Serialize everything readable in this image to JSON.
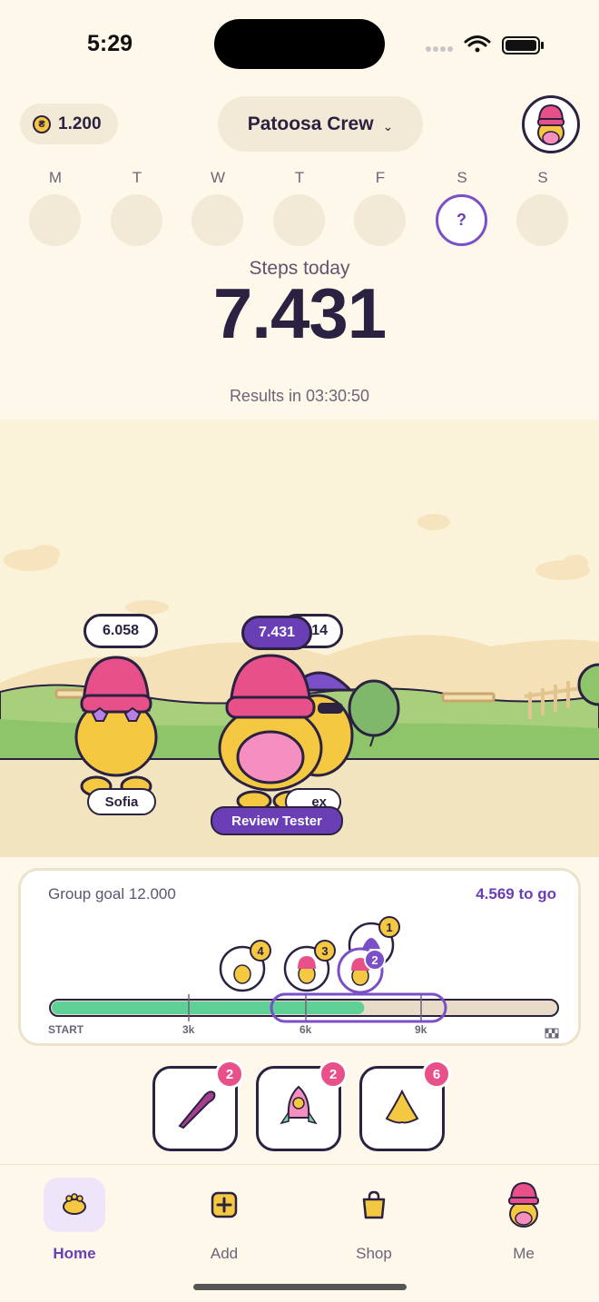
{
  "status_bar": {
    "time": "5:29"
  },
  "header": {
    "coins": "1.200",
    "coin_symbol": "₴",
    "group_name": "Patoosa Crew",
    "chevron": "⌄"
  },
  "week": {
    "days": [
      {
        "letter": "M",
        "state": "past"
      },
      {
        "letter": "T",
        "state": "past"
      },
      {
        "letter": "W",
        "state": "past"
      },
      {
        "letter": "T",
        "state": "past"
      },
      {
        "letter": "F",
        "state": "past"
      },
      {
        "letter": "S",
        "state": "today",
        "mark": "?"
      },
      {
        "letter": "S",
        "state": "future"
      }
    ]
  },
  "steps": {
    "label": "Steps today",
    "value": "7.431",
    "results": "Results in 03:30:50"
  },
  "scene": {
    "sofia": {
      "steps": "6.058",
      "name": "Sofia"
    },
    "you": {
      "steps": "7.431",
      "name": "Review Tester"
    },
    "alex": {
      "steps_partial": "14",
      "name_partial": "ex"
    }
  },
  "goal": {
    "title": "Group goal 12.000",
    "to_go": "4.569 to go",
    "target": 12000,
    "current": 7431,
    "ticks": [
      {
        "label": "START",
        "value": 0
      },
      {
        "label": "3k",
        "value": 3000
      },
      {
        "label": "6k",
        "value": 6000
      },
      {
        "label": "9k",
        "value": 9000
      }
    ],
    "ranks": [
      "1",
      "2",
      "3",
      "4"
    ]
  },
  "boosters": [
    {
      "icon": "bat-icon",
      "count": "2"
    },
    {
      "icon": "rocket-icon",
      "count": "2"
    },
    {
      "icon": "banana-icon",
      "count": "6"
    }
  ],
  "tabs": [
    {
      "label": "Home",
      "active": true
    },
    {
      "label": "Add",
      "active": false
    },
    {
      "label": "Shop",
      "active": false
    },
    {
      "label": "Me",
      "active": false
    }
  ],
  "colors": {
    "accent": "#6a3eb5",
    "badge": "#e8508a",
    "progress": "#5fd196",
    "background": "#fdf8ea"
  }
}
